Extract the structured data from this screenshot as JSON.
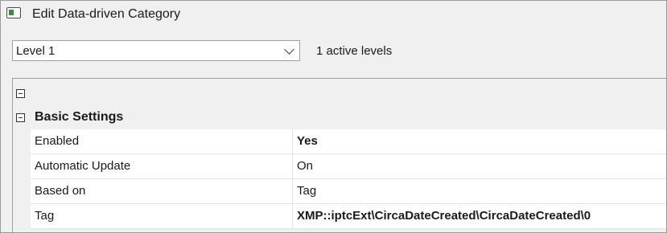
{
  "window": {
    "title": "Edit Data-driven Category",
    "icon": "category-window-icon"
  },
  "level_select": {
    "value": "Level 1",
    "icon": "chevron-down-icon"
  },
  "active_levels": "1 active levels",
  "grid": {
    "root_group": {
      "label": "",
      "expanded": true
    },
    "basic_settings": {
      "label": "Basic Settings",
      "expanded": true,
      "rows": [
        {
          "name": "Enabled",
          "value": "Yes",
          "bold": true
        },
        {
          "name": "Automatic Update",
          "value": "On",
          "bold": false
        },
        {
          "name": "Based on",
          "value": "Tag",
          "bold": false
        },
        {
          "name": "Tag",
          "value": "XMP::iptcExt\\CircaDateCreated\\CircaDateCreated\\0",
          "bold": true
        }
      ]
    }
  }
}
